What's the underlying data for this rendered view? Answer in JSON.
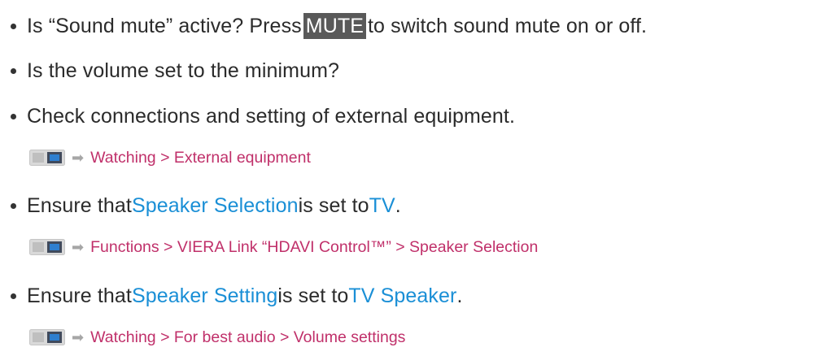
{
  "items": [
    {
      "pre": "Is “Sound mute” active? Press ",
      "key": "MUTE",
      "post": " to switch sound mute on or off."
    },
    {
      "text": "Is the volume set to the minimum?"
    },
    {
      "text": "Check connections and setting of external equipment.",
      "ref": "Watching > External equipment"
    },
    {
      "pre": "Ensure that ",
      "link1": "Speaker Selection",
      "mid": " is set to ",
      "link2": "TV",
      "post": ".",
      "ref": "Functions > VIERA Link “HDAVI Control™” > Speaker Selection"
    },
    {
      "pre": "Ensure that ",
      "link1": "Speaker Setting",
      "mid": " is set to ",
      "link2": "TV Speaker",
      "post": ".",
      "ref": "Watching > For best audio > Volume settings"
    }
  ],
  "icons": {
    "ref_book": "ebook-reference-icon",
    "ref_arrow": "arrow-right-icon"
  },
  "colors": {
    "text": "#2b2b2b",
    "link_blue": "#1a8fd6",
    "ref_link": "#c0306a",
    "key_bg": "#595959"
  }
}
